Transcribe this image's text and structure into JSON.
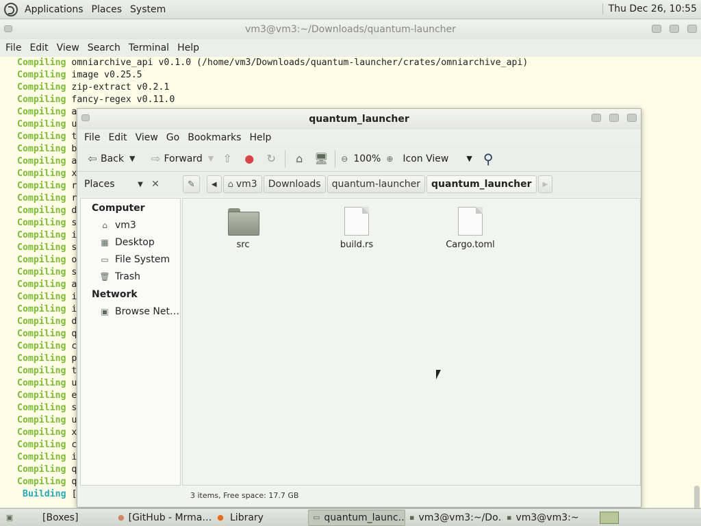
{
  "topbar": {
    "menus": [
      "Applications",
      "Places",
      "System"
    ],
    "clock": "Thu Dec 26, 10:55"
  },
  "terminal": {
    "title": "vm3@vm3:~/Downloads/quantum-launcher",
    "menu": [
      "File",
      "Edit",
      "View",
      "Search",
      "Terminal",
      "Help"
    ],
    "lines": [
      {
        "kw": "Compiling",
        "text": " omniarchive_api v0.1.0 (/home/vm3/Downloads/quantum-launcher/crates/omniarchive_api)"
      },
      {
        "kw": "Compiling",
        "text": " image v0.25.5"
      },
      {
        "kw": "Compiling",
        "text": " zip-extract v0.2.1"
      },
      {
        "kw": "Compiling",
        "text": " fancy-regex v0.11.0"
      },
      {
        "kw": "Compiling",
        "text": " a"
      },
      {
        "kw": "Compiling",
        "text": " u"
      },
      {
        "kw": "Compiling",
        "text": " t"
      },
      {
        "kw": "Compiling",
        "text": " b"
      },
      {
        "kw": "Compiling",
        "text": " a"
      },
      {
        "kw": "Compiling",
        "text": " x"
      },
      {
        "kw": "Compiling",
        "text": " r"
      },
      {
        "kw": "Compiling",
        "text": " r"
      },
      {
        "kw": "Compiling",
        "text": " d"
      },
      {
        "kw": "Compiling",
        "text": " s"
      },
      {
        "kw": "Compiling",
        "text": " i"
      },
      {
        "kw": "Compiling",
        "text": " s"
      },
      {
        "kw": "Compiling",
        "text": " o"
      },
      {
        "kw": "Compiling",
        "text": " s"
      },
      {
        "kw": "Compiling",
        "text": " a"
      },
      {
        "kw": "Compiling",
        "text": " i"
      },
      {
        "kw": "Compiling",
        "text": " i"
      },
      {
        "kw": "Compiling",
        "text": " d"
      },
      {
        "kw": "Compiling",
        "text": " q"
      },
      {
        "kw": "Compiling",
        "text": " c"
      },
      {
        "kw": "Compiling",
        "text": " p"
      },
      {
        "kw": "Compiling",
        "text": " t"
      },
      {
        "kw": "Compiling",
        "text": " u"
      },
      {
        "kw": "Compiling",
        "text": " e"
      },
      {
        "kw": "Compiling",
        "text": " s"
      },
      {
        "kw": "Compiling",
        "text": " u"
      },
      {
        "kw": "Compiling",
        "text": " x"
      },
      {
        "kw": "Compiling",
        "text": " c"
      },
      {
        "kw": "Compiling",
        "text": " i"
      },
      {
        "kw": "Compiling",
        "text": " q"
      },
      {
        "kw": "Compiling",
        "text": " q"
      }
    ],
    "building": {
      "kw": "Building",
      "text": " ["
    }
  },
  "filemanager": {
    "title": "quantum_launcher",
    "menu": [
      "File",
      "Edit",
      "View",
      "Go",
      "Bookmarks",
      "Help"
    ],
    "toolbar": {
      "back": "Back",
      "forward": "Forward",
      "zoom": "100%",
      "view_mode": "Icon View"
    },
    "places_label": "Places",
    "breadcrumbs": [
      "vm3",
      "Downloads",
      "quantum-launcher",
      "quantum_launcher"
    ],
    "sidebar": {
      "computer_header": "Computer",
      "computer_items": [
        "vm3",
        "Desktop",
        "File System",
        "Trash"
      ],
      "network_header": "Network",
      "network_items": [
        "Browse Net…"
      ]
    },
    "files": [
      {
        "name": "src",
        "type": "folder"
      },
      {
        "name": "build.rs",
        "type": "file"
      },
      {
        "name": "Cargo.toml",
        "type": "file"
      }
    ],
    "status": "3 items, Free space: 17.7 GB"
  },
  "taskbar": {
    "items": [
      {
        "label": "[Boxes]",
        "icon": "boxes-icon"
      },
      {
        "label": "[GitHub - Mrma…",
        "icon": "browser-icon"
      },
      {
        "label": "Library",
        "icon": "firefox-icon"
      },
      {
        "label": "quantum_launc…",
        "icon": "folder-icon"
      },
      {
        "label": "vm3@vm3:~/Do…",
        "icon": "terminal-icon"
      },
      {
        "label": "vm3@vm3:~",
        "icon": "terminal-icon"
      }
    ]
  }
}
